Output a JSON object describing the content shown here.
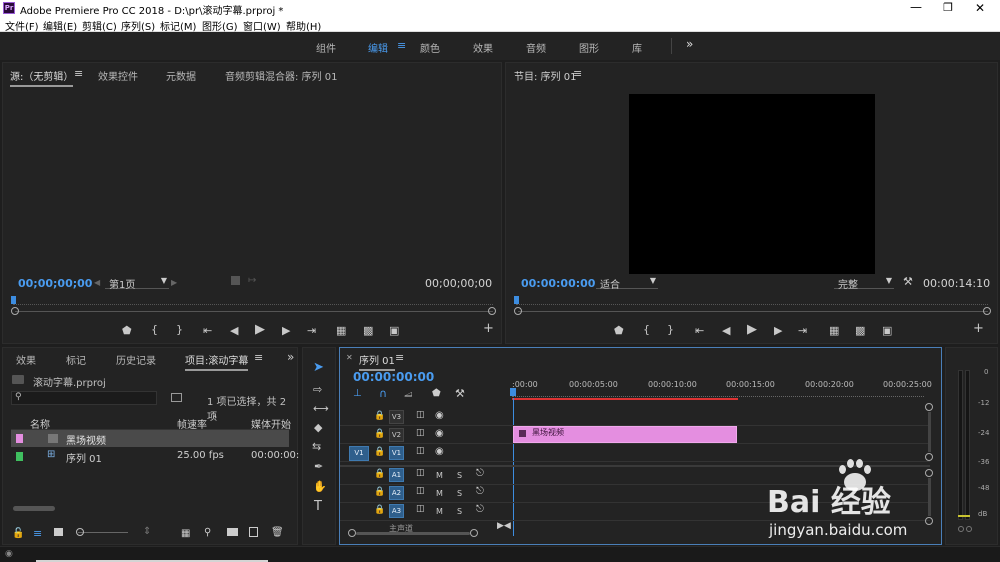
{
  "window": {
    "title": "Adobe Premiere Pro CC 2018 - D:\\pr\\滚动字幕.prproj *",
    "app_icon": "Pr"
  },
  "menu": [
    "文件(F)",
    "编辑(E)",
    "剪辑(C)",
    "序列(S)",
    "标记(M)",
    "图形(G)",
    "窗口(W)",
    "帮助(H)"
  ],
  "workspaces": {
    "items": [
      "组件",
      "编辑",
      "颜色",
      "效果",
      "音频",
      "图形",
      "库"
    ],
    "active": "编辑",
    "more": "»"
  },
  "source_panel": {
    "tabs": [
      "源:（无剪辑）",
      "效果控件",
      "元数据",
      "音频剪辑混合器: 序列 01"
    ],
    "timecode_left": "00;00;00;00",
    "page_select": "第1页",
    "timecode_right": "00;00;00;00"
  },
  "program_panel": {
    "title": "节目: 序列 01",
    "timecode_left": "00:00:00:00",
    "fit_select": "适合",
    "quality_select": "完整",
    "timecode_right": "00:00:14:10"
  },
  "project_panel": {
    "tabs": [
      "效果",
      "标记",
      "历史记录",
      "项目:滚动字幕"
    ],
    "file": "滚动字幕.prproj",
    "selection_info": "1 项已选择，共 2 项",
    "columns": [
      "名称",
      "帧速率",
      "媒体开始"
    ],
    "rows": [
      {
        "name": "黑场视频",
        "fps": "",
        "start": "",
        "color": "#e48ee0",
        "selected": true
      },
      {
        "name": "序列 01",
        "fps": "25.00 fps",
        "start": "00:00:00:",
        "color": "#3fbf5f",
        "selected": false
      }
    ]
  },
  "timeline": {
    "tab": "序列 01",
    "timecode": "00:00:00:00",
    "ruler": [
      ":00:00",
      "00:00:05:00",
      "00:00:10:00",
      "00:00:15:00",
      "00:00:20:00",
      "00:00:25:00"
    ],
    "video_tracks": [
      "V3",
      "V2",
      "V1"
    ],
    "audio_tracks": [
      "A1",
      "A2",
      "A3"
    ],
    "source_patch": "V1",
    "mute_label": "M",
    "solo_label": "S",
    "master_label": "主声道",
    "clip": {
      "name": "黑场视频",
      "track": "V2",
      "start_sec": 0,
      "end_sec": 14.4,
      "color": "#e48ee0"
    }
  },
  "meter": {
    "scale": [
      "0",
      "-12",
      "-24",
      "-36",
      "-48",
      "dB"
    ]
  },
  "watermark": {
    "text": "Bai 经验",
    "url": "jingyan.baidu.com"
  }
}
